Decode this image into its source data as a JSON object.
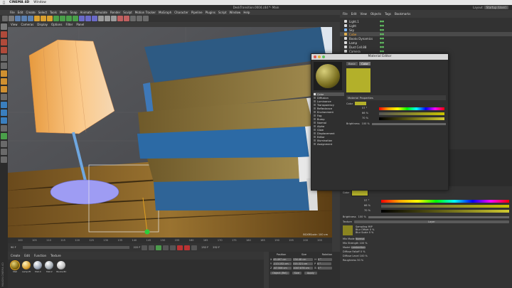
{
  "os_menubar": {
    "app": "CINEMA 4D",
    "window": "Window"
  },
  "window_title": "DeskTransition.0004.c4d *- Main",
  "layout_label": "Layout:",
  "layout_value": "Startup (User)",
  "main_menu": [
    "File",
    "Edit",
    "Create",
    "Select",
    "Tools",
    "Mesh",
    "Snap",
    "Animate",
    "Simulate",
    "Render",
    "Sculpt",
    "Motion Tracker",
    "MoGraph",
    "Character",
    "Pipeline",
    "Plugins",
    "Script",
    "Window",
    "Help"
  ],
  "viewport_menu": [
    "View",
    "Cameras",
    "Display",
    "Options",
    "Filter",
    "Panel"
  ],
  "viewport_overlay": "BGXRScale: 100 cm",
  "ruler_ticks": [
    "100",
    "105",
    "110",
    "115",
    "120",
    "125",
    "130",
    "135",
    "140",
    "145",
    "150",
    "155",
    "160",
    "165",
    "170",
    "175",
    "180",
    "185",
    "190",
    "195",
    "200",
    "205"
  ],
  "timeline": {
    "current_frame_marker": "222 F",
    "start": "90 F",
    "end": "252 F",
    "end2": "252 F"
  },
  "material_manager": {
    "menu": [
      "Create",
      "Edit",
      "Function",
      "Texture"
    ],
    "materials": [
      "Mat",
      "Lamp.Et",
      "Mat.4",
      "Mat.2",
      "Books.8C"
    ]
  },
  "coordinates": {
    "headers": [
      "Position",
      "Size",
      "Rotation"
    ],
    "rows": [
      {
        "axis": "X",
        "pos": "49.497 cm",
        "size": "234.48 cm",
        "rot_label": "H",
        "rot": "0 °"
      },
      {
        "axis": "Y",
        "pos": "-113.152 cm",
        "size": "315.321 cm",
        "rot_label": "P",
        "rot": "0 °"
      },
      {
        "axis": "Z",
        "pos": "-67.506 cm",
        "size": "1007.876 cm",
        "rot_label": "B",
        "rot": "0 °"
      }
    ],
    "mode_select": "Object (Rel)",
    "size_select": "Size",
    "apply_label": "Apply"
  },
  "object_manager": {
    "menu": [
      "File",
      "Edit",
      "View",
      "Objects",
      "Tags",
      "Bookmarks"
    ],
    "objects": [
      {
        "name": "Light.1",
        "color": "#d8d8d8"
      },
      {
        "name": "Light",
        "color": "#d8d8d8"
      },
      {
        "name": "Sky",
        "color": "#7fb8ff"
      },
      {
        "name": "Cube",
        "color": "#e0b050"
      },
      {
        "name": "Books Dynamics",
        "color": "#d8d8d8"
      },
      {
        "name": "Lamp",
        "color": "#d8d8d8"
      },
      {
        "name": "Dust Cell.88",
        "color": "#d8d8d8"
      },
      {
        "name": "Camera",
        "color": "#d8d8d8"
      }
    ]
  },
  "material_editor": {
    "title": "Material Editor",
    "tab_basic": "Basic",
    "tab_color": "Color",
    "channels": [
      "Color",
      "Diffusion",
      "Luminance",
      "Transparency",
      "Reflectance",
      "Environment",
      "Fog",
      "Bump",
      "Normal",
      "Alpha",
      "Glow",
      "Displacement",
      "Editor",
      "Illumination",
      "Assignment"
    ],
    "channel_checked": [
      true,
      false,
      false,
      false,
      false,
      false,
      false,
      false,
      false,
      false,
      false,
      false,
      false,
      false,
      false
    ],
    "section": "Material Properties",
    "color_label": "Color",
    "h_label": "H",
    "h_value": "57 °",
    "s_label": "S",
    "s_value": "66 %",
    "v_label": "V",
    "v_value": "70 %",
    "brightness_label": "Brightness",
    "brightness_value": "100 %",
    "swatch_color": "#b3b02a"
  },
  "attributes": {
    "color_label": "Color",
    "h": "57 °",
    "s": "66 %",
    "v": "70 %",
    "brightness_label": "Brightness",
    "brightness_value": "100 %",
    "texture_label": "Texture",
    "texture_value": "Layer",
    "sampling_label": "Sampling",
    "sampling_value": "MIP",
    "blur_offset_label": "Blur Offset",
    "blur_offset_value": "0 %",
    "blur_scale_label": "Blur Scale",
    "blur_scale_value": "0 %",
    "mix_mode_label": "Mix Mode",
    "mix_mode_value": "Normal",
    "mix_strength_label": "Mix Strength",
    "mix_strength_value": "100 %",
    "model_label": "Model",
    "model_value": "Lambertian",
    "diffuse_falloff_label": "Diffuse Falloff",
    "diffuse_falloff_value": "0 %",
    "diffuse_level_label": "Diffuse Level",
    "diffuse_level_value": "100 %",
    "roughness_label": "Roughness",
    "roughness_value": "50 %"
  },
  "side_label": "MAXON CINEMA 4D"
}
